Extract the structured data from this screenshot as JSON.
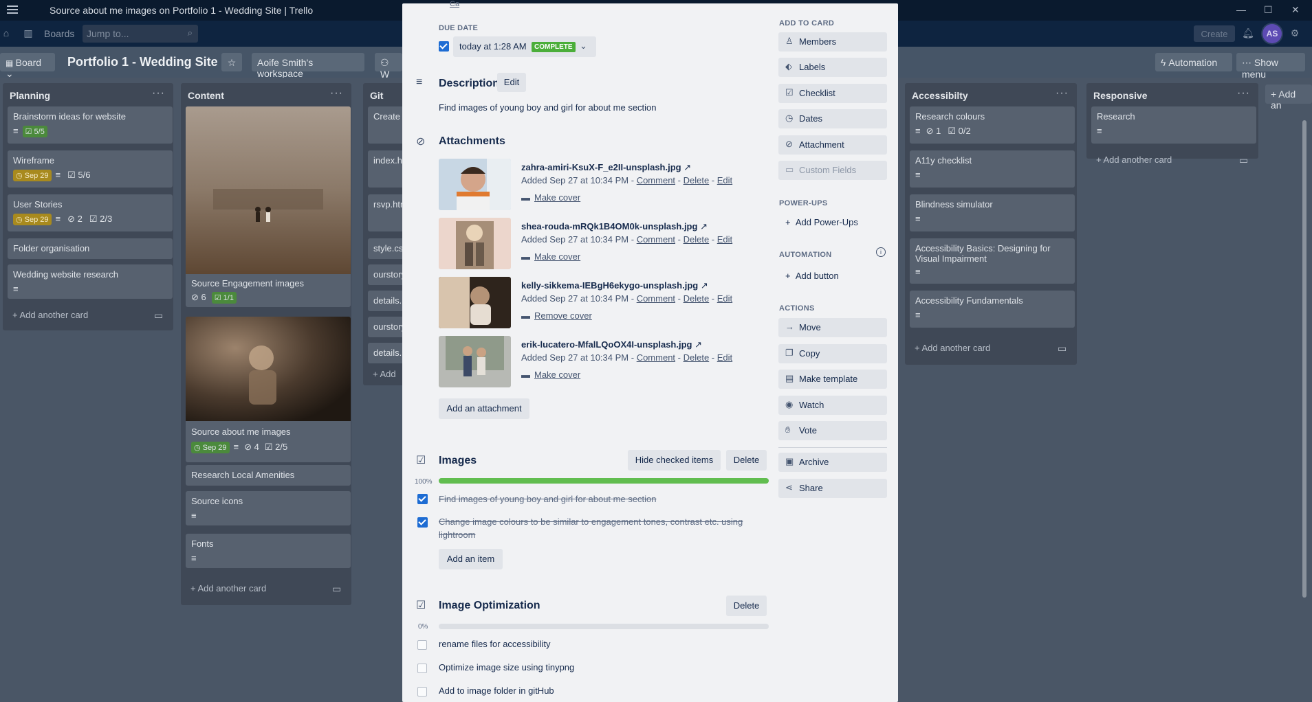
{
  "window": {
    "title": "Source about me images on Portfolio 1 - Wedding Site | Trello",
    "controls": [
      "—",
      "☐",
      "✕"
    ]
  },
  "header": {
    "boards_label": "Boards",
    "search_placeholder": "Jump to...",
    "create_label": "Create",
    "avatar_initials": "AS"
  },
  "boardbar": {
    "view_label": "Board",
    "board_title": "Portfolio 1 - Wedding Site",
    "workspace_label": "Aoife Smith's workspace",
    "visibility_label": "W",
    "automation_label": "Automation",
    "show_menu_label": "Show menu"
  },
  "lists": [
    {
      "title": "Planning",
      "cards": [
        {
          "title": "Brainstorm ideas for website",
          "checklist": "5/5"
        },
        {
          "title": "Wireframe",
          "due": "Sep 29",
          "checklist": "5/6"
        },
        {
          "title": "User Stories",
          "due": "Sep 29",
          "attachments": "2",
          "checklist": "2/3"
        },
        {
          "title": "Folder organisation"
        },
        {
          "title": "Wedding website research"
        }
      ],
      "add_card": "Add another card"
    },
    {
      "title": "Content",
      "cards": [
        {
          "title": "Source Engagement images",
          "attachments": "6",
          "checklist": "1/1"
        },
        {
          "title": "Source about me images",
          "due": "Sep 29",
          "attachments": "4",
          "checklist": "2/5"
        },
        {
          "title": "Research Local Amenities"
        },
        {
          "title": "Source icons"
        },
        {
          "title": "Fonts"
        }
      ],
      "add_card": "Add another card"
    },
    {
      "title": "Git",
      "cards": [
        {
          "title": "Create R"
        },
        {
          "title": "index.htm"
        },
        {
          "title": "rsvp.htm"
        },
        {
          "title": "style.css"
        },
        {
          "title": "ourstory"
        },
        {
          "title": "details.h"
        },
        {
          "title": "ourstory"
        },
        {
          "title": "details.h"
        }
      ],
      "add_card": "Add"
    },
    {
      "title": "Accessibilty",
      "cards": [
        {
          "title": "Research colours",
          "attachments": "1",
          "checklist": "0/2"
        },
        {
          "title": "A11y checklist"
        },
        {
          "title": "Blindness simulator"
        },
        {
          "title": "Accessibility Basics: Designing for Visual Impairment"
        },
        {
          "title": "Accessibility Fundamentals"
        }
      ],
      "add_card": "Add another card"
    },
    {
      "title": "Responsive",
      "cards": [
        {
          "title": "Research"
        }
      ],
      "add_card": "Add another card"
    }
  ],
  "add_list_label": "Add an",
  "modal": {
    "top_cut_label": "Ca",
    "due": {
      "label": "DUE DATE",
      "value": "today at 1:28 AM",
      "status": "COMPLETE"
    },
    "description": {
      "title": "Description",
      "edit_label": "Edit",
      "text": "Find images of young boy and girl for about me section"
    },
    "attachments": {
      "title": "Attachments",
      "items": [
        {
          "name": "zahra-amiri-KsuX-F_e2II-unsplash.jpg",
          "added": "Added Sep 27 at 10:34 PM",
          "comment": "Comment",
          "delete": "Delete",
          "edit": "Edit",
          "cover": "Make cover"
        },
        {
          "name": "shea-rouda-mRQk1B4OM0k-unsplash.jpg",
          "added": "Added Sep 27 at 10:34 PM",
          "comment": "Comment",
          "delete": "Delete",
          "edit": "Edit",
          "cover": "Make cover"
        },
        {
          "name": "kelly-sikkema-IEBgH6ekygo-unsplash.jpg",
          "added": "Added Sep 27 at 10:34 PM",
          "comment": "Comment",
          "delete": "Delete",
          "edit": "Edit",
          "cover": "Remove cover"
        },
        {
          "name": "erik-lucatero-MfalLQoOX4I-unsplash.jpg",
          "added": "Added Sep 27 at 10:34 PM",
          "comment": "Comment",
          "delete": "Delete",
          "edit": "Edit",
          "cover": "Make cover"
        }
      ],
      "add_label": "Add an attachment"
    },
    "checklist1": {
      "title": "Images",
      "hide_label": "Hide checked items",
      "delete_label": "Delete",
      "progress": "100%",
      "progress_value": 1.0,
      "items": [
        {
          "text": "Find images of young boy and girl for about me section",
          "done": true
        },
        {
          "text": "Change image colours to be similar to engagement tones, contrast etc. using",
          "text2": "lightroom",
          "done": true
        }
      ],
      "add_label": "Add an item"
    },
    "checklist2": {
      "title": "Image Optimization",
      "delete_label": "Delete",
      "progress": "0%",
      "progress_value": 0.0,
      "items": [
        {
          "text": "rename files for accessibility",
          "done": false
        },
        {
          "text": "Optimize image size using tinypng",
          "done": false
        },
        {
          "text": "Add to image folder in gitHub",
          "done": false
        }
      ]
    },
    "sidebar": {
      "add_to_card": "ADD TO CARD",
      "add_items": [
        "Members",
        "Labels",
        "Checklist",
        "Dates",
        "Attachment",
        "Custom Fields"
      ],
      "powerups_head": "POWER-UPS",
      "add_powerups": "Add Power-Ups",
      "automation_head": "AUTOMATION",
      "add_button": "Add button",
      "actions_head": "ACTIONS",
      "actions": [
        "Move",
        "Copy",
        "Make template",
        "Watch",
        "Vote",
        "Archive",
        "Share"
      ]
    }
  },
  "colors": {
    "green": "#61bd4f",
    "blue": "#1d6cd3",
    "yellow": "#a88a1e"
  }
}
